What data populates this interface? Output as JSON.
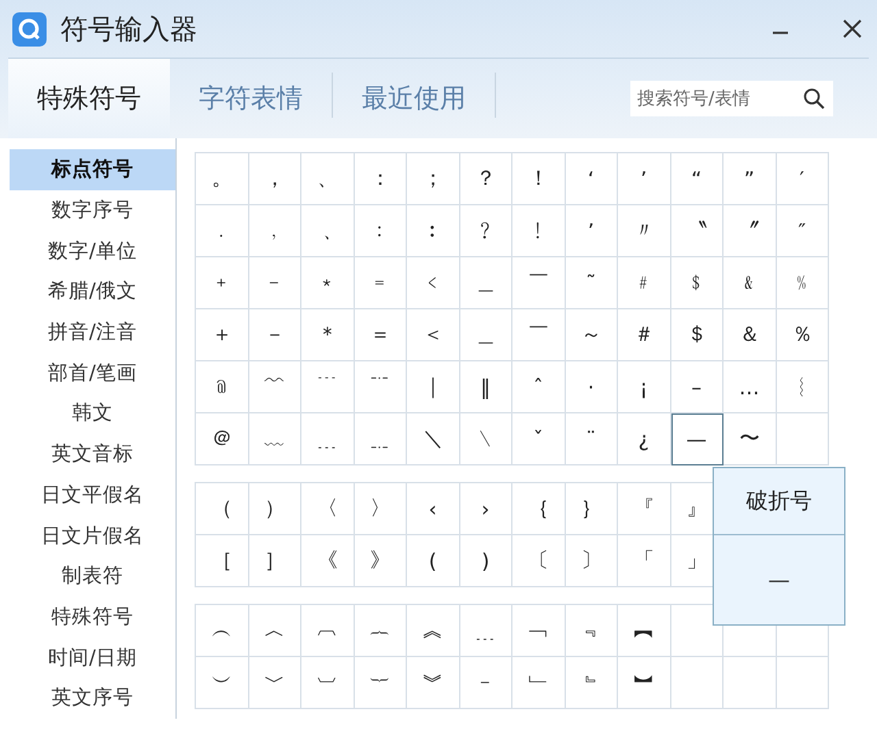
{
  "window": {
    "title": "符号输入器"
  },
  "tabs": [
    {
      "label": "特殊符号",
      "selected": true
    },
    {
      "label": "字符表情",
      "selected": false
    },
    {
      "label": "最近使用",
      "selected": false
    }
  ],
  "search": {
    "placeholder": "搜索符号/表情"
  },
  "sidebar": {
    "items": [
      {
        "label": "标点符号",
        "selected": true
      },
      {
        "label": "数字序号",
        "selected": false
      },
      {
        "label": "数字/单位",
        "selected": false
      },
      {
        "label": "希腊/俄文",
        "selected": false
      },
      {
        "label": "拼音/注音",
        "selected": false
      },
      {
        "label": "部首/笔画",
        "selected": false
      },
      {
        "label": "韩文",
        "selected": false
      },
      {
        "label": "英文音标",
        "selected": false
      },
      {
        "label": "日文平假名",
        "selected": false
      },
      {
        "label": "日文片假名",
        "selected": false
      },
      {
        "label": "制表符",
        "selected": false
      },
      {
        "label": "特殊符号",
        "selected": false
      },
      {
        "label": "时间/日期",
        "selected": false
      },
      {
        "label": "英文序号",
        "selected": false
      }
    ]
  },
  "symbol_groups": [
    {
      "rows": [
        [
          {
            "symbol": "。",
            "selected": false
          },
          {
            "symbol": "，",
            "selected": false
          },
          {
            "symbol": "、",
            "selected": false
          },
          {
            "symbol": "：",
            "selected": false
          },
          {
            "symbol": "；",
            "selected": false
          },
          {
            "symbol": "？",
            "selected": false
          },
          {
            "symbol": "！",
            "selected": false
          },
          {
            "symbol": "‘",
            "selected": false
          },
          {
            "symbol": "’",
            "selected": false
          },
          {
            "symbol": "“",
            "selected": false
          },
          {
            "symbol": "”",
            "selected": false
          },
          {
            "symbol": "′",
            "selected": false
          }
        ],
        [
          {
            "symbol": "﹒",
            "selected": false
          },
          {
            "symbol": "﹐",
            "selected": false
          },
          {
            "symbol": "﹑",
            "selected": false
          },
          {
            "symbol": "﹕",
            "selected": false
          },
          {
            "symbol": "︰",
            "selected": false
          },
          {
            "symbol": "﹖",
            "selected": false
          },
          {
            "symbol": "﹗",
            "selected": false
          },
          {
            "symbol": "ʼ",
            "selected": false
          },
          {
            "symbol": "〃",
            "selected": false
          },
          {
            "symbol": "〝",
            "selected": false
          },
          {
            "symbol": "〞",
            "selected": false
          },
          {
            "symbol": "″",
            "selected": false
          }
        ],
        [
          {
            "symbol": "﹢",
            "selected": false
          },
          {
            "symbol": "﹣",
            "selected": false
          },
          {
            "symbol": "﹡",
            "selected": false
          },
          {
            "symbol": "﹦",
            "selected": false
          },
          {
            "symbol": "﹤",
            "selected": false
          },
          {
            "symbol": "＿",
            "selected": false
          },
          {
            "symbol": "￣",
            "selected": false
          },
          {
            "symbol": "˜",
            "selected": false
          },
          {
            "symbol": "﹟",
            "selected": false
          },
          {
            "symbol": "﹩",
            "selected": false
          },
          {
            "symbol": "﹠",
            "selected": false
          },
          {
            "symbol": "﹪",
            "selected": false
          }
        ],
        [
          {
            "symbol": "＋",
            "selected": false
          },
          {
            "symbol": "－",
            "selected": false
          },
          {
            "symbol": "＊",
            "selected": false
          },
          {
            "symbol": "＝",
            "selected": false
          },
          {
            "symbol": "＜",
            "selected": false
          },
          {
            "symbol": "＿",
            "selected": false
          },
          {
            "symbol": "￣",
            "selected": false
          },
          {
            "symbol": "～",
            "selected": false
          },
          {
            "symbol": "＃",
            "selected": false
          },
          {
            "symbol": "＄",
            "selected": false
          },
          {
            "symbol": "＆",
            "selected": false
          },
          {
            "symbol": "％",
            "selected": false
          }
        ],
        [
          {
            "symbol": "﹫",
            "selected": false
          },
          {
            "symbol": "﹌",
            "selected": false
          },
          {
            "symbol": "﹉",
            "selected": false
          },
          {
            "symbol": "﹊",
            "selected": false
          },
          {
            "symbol": "｜",
            "selected": false
          },
          {
            "symbol": "‖",
            "selected": false
          },
          {
            "symbol": "ˆ",
            "selected": false
          },
          {
            "symbol": "·",
            "selected": false
          },
          {
            "symbol": "¡",
            "selected": false
          },
          {
            "symbol": "–",
            "selected": false
          },
          {
            "symbol": "…",
            "selected": false
          },
          {
            "symbol": "︴",
            "selected": false
          }
        ],
        [
          {
            "symbol": "＠",
            "selected": false
          },
          {
            "symbol": "﹏",
            "selected": false
          },
          {
            "symbol": "﹍",
            "selected": false
          },
          {
            "symbol": "﹎",
            "selected": false
          },
          {
            "symbol": "＼",
            "selected": false
          },
          {
            "symbol": "﹨",
            "selected": false
          },
          {
            "symbol": "ˇ",
            "selected": false
          },
          {
            "symbol": "¨",
            "selected": false
          },
          {
            "symbol": "¿",
            "selected": false
          },
          {
            "symbol": "—",
            "selected": true
          },
          {
            "symbol": "〜",
            "selected": false
          }
        ]
      ]
    },
    {
      "rows": [
        [
          {
            "symbol": "（",
            "selected": false
          },
          {
            "symbol": "）",
            "selected": false
          },
          {
            "symbol": "〈",
            "selected": false
          },
          {
            "symbol": "〉",
            "selected": false
          },
          {
            "symbol": "‹",
            "selected": false
          },
          {
            "symbol": "›",
            "selected": false
          },
          {
            "symbol": "｛",
            "selected": false
          },
          {
            "symbol": "｝",
            "selected": false
          },
          {
            "symbol": "『",
            "selected": false
          },
          {
            "symbol": "』",
            "selected": false
          }
        ],
        [
          {
            "symbol": "［",
            "selected": false
          },
          {
            "symbol": "］",
            "selected": false
          },
          {
            "symbol": "《",
            "selected": false
          },
          {
            "symbol": "》",
            "selected": false
          },
          {
            "symbol": "(",
            "selected": false
          },
          {
            "symbol": ")",
            "selected": false
          },
          {
            "symbol": "〔",
            "selected": false
          },
          {
            "symbol": "〕",
            "selected": false
          },
          {
            "symbol": "「",
            "selected": false
          },
          {
            "symbol": "」",
            "selected": false
          }
        ]
      ]
    },
    {
      "rows": [
        [
          {
            "symbol": "︵",
            "selected": false
          },
          {
            "symbol": "︿",
            "selected": false
          },
          {
            "symbol": "︹",
            "selected": false
          },
          {
            "symbol": "︷",
            "selected": false
          },
          {
            "symbol": "︽",
            "selected": false
          },
          {
            "symbol": "﹍",
            "selected": false
          },
          {
            "symbol": "﹁",
            "selected": false
          },
          {
            "symbol": "﹃",
            "selected": false
          },
          {
            "symbol": "︻",
            "selected": false
          }
        ],
        [
          {
            "symbol": "︶",
            "selected": false
          },
          {
            "symbol": "﹀",
            "selected": false
          },
          {
            "symbol": "︺",
            "selected": false
          },
          {
            "symbol": "︸",
            "selected": false
          },
          {
            "symbol": "︾",
            "selected": false
          },
          {
            "symbol": "﹣",
            "selected": false
          },
          {
            "symbol": "﹂",
            "selected": false
          },
          {
            "symbol": "﹄",
            "selected": false
          },
          {
            "symbol": "︼",
            "selected": false
          }
        ]
      ]
    }
  ],
  "tooltip": {
    "title": "破折号",
    "symbol": "—"
  }
}
